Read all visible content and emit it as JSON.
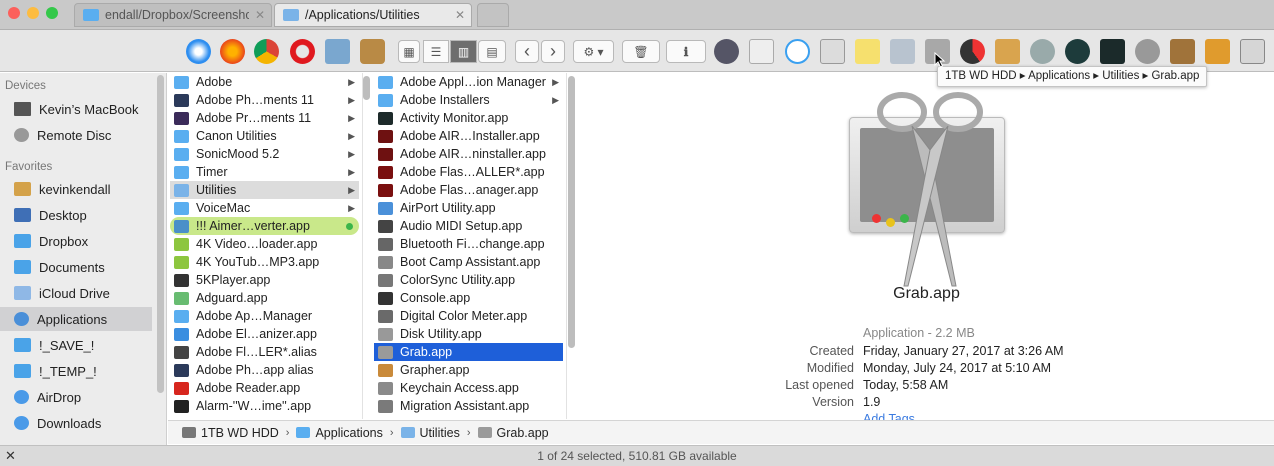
{
  "tabs": [
    {
      "label": "endall/Dropbox/Screenshots",
      "close": "✕",
      "active": false
    },
    {
      "label": "/Applications/Utilities",
      "close": "✕",
      "active": true
    }
  ],
  "toolbar": {
    "tooltip": "1TB WD HDD ▸ Applications ▸ Utilities ▸ Grab.app",
    "back": "‹",
    "forward": "›",
    "action": "⚙ ▾",
    "trash": "🗑",
    "info": "ℹ"
  },
  "sidebar": {
    "devices_header": "Devices",
    "devices": [
      {
        "label": "Kevin’s MacBook",
        "icon": "laptop-icon"
      },
      {
        "label": "Remote Disc",
        "icon": "disc-icon"
      }
    ],
    "favorites_header": "Favorites",
    "favorites": [
      {
        "label": "kevinkendall",
        "icon": "home-icon"
      },
      {
        "label": "Desktop",
        "icon": "desktop-icon"
      },
      {
        "label": "Dropbox",
        "icon": "folder-icon"
      },
      {
        "label": "Documents",
        "icon": "folder-icon"
      },
      {
        "label": "iCloud Drive",
        "icon": "cloud-icon"
      },
      {
        "label": "Applications",
        "icon": "applications-icon",
        "selected": true
      },
      {
        "label": "!_SAVE_!",
        "icon": "folder-icon"
      },
      {
        "label": "!_TEMP_!",
        "icon": "folder-icon"
      },
      {
        "label": "AirDrop",
        "icon": "airdrop-icon"
      },
      {
        "label": "Downloads",
        "icon": "downloads-icon"
      }
    ]
  },
  "column1": [
    {
      "label": "Adobe",
      "icon": "#5aaef0",
      "arrow": true
    },
    {
      "label": "Adobe Ph…ments 11",
      "icon": "#2b3a5a",
      "arrow": true
    },
    {
      "label": "Adobe Pr…ments 11",
      "icon": "#3b2b5a",
      "arrow": true
    },
    {
      "label": "Canon Utilities",
      "icon": "#5aaef0",
      "arrow": true
    },
    {
      "label": "SonicMood 5.2",
      "icon": "#5aaef0",
      "arrow": true
    },
    {
      "label": "Timer",
      "icon": "#5aaef0",
      "arrow": true
    },
    {
      "label": "Utilities",
      "icon": "#7ab3e8",
      "arrow": true,
      "selected": true
    },
    {
      "label": "VoiceMac",
      "icon": "#5aaef0",
      "arrow": true
    },
    {
      "label": "!!! Aimer…verter.app",
      "icon": "#4a90c8",
      "tag": true
    },
    {
      "label": "4K Video…loader.app",
      "icon": "#8dc63f"
    },
    {
      "label": "4K YouTub…MP3.app",
      "icon": "#8dc63f"
    },
    {
      "label": "5KPlayer.app",
      "icon": "#333333"
    },
    {
      "label": "Adguard.app",
      "icon": "#68bc71"
    },
    {
      "label": "Adobe Ap…Manager",
      "icon": "#5aaef0"
    },
    {
      "label": "Adobe El…anizer.app",
      "icon": "#3a8ee0"
    },
    {
      "label": "Adobe Fl…LER*.alias",
      "icon": "#444444"
    },
    {
      "label": "Adobe Ph…app alias",
      "icon": "#2b3a5a"
    },
    {
      "label": "Adobe Reader.app",
      "icon": "#d7261e"
    },
    {
      "label": "Alarm-''W…ime''.app",
      "icon": "#222222"
    }
  ],
  "column2": [
    {
      "label": "Adobe Appl…ion Manager",
      "icon": "#5aaef0",
      "arrow": true
    },
    {
      "label": "Adobe Installers",
      "icon": "#5aaef0",
      "arrow": true
    },
    {
      "label": "Activity Monitor.app",
      "icon": "#1d2a2a"
    },
    {
      "label": "Adobe AIR…Installer.app",
      "icon": "#6e1111"
    },
    {
      "label": "Adobe AIR…ninstaller.app",
      "icon": "#6e1111"
    },
    {
      "label": "Adobe Flas…ALLER*.app",
      "icon": "#7a0f0f"
    },
    {
      "label": "Adobe Flas…anager.app",
      "icon": "#7a0f0f"
    },
    {
      "label": "AirPort Utility.app",
      "icon": "#4a90d9"
    },
    {
      "label": "Audio MIDI Setup.app",
      "icon": "#444444"
    },
    {
      "label": "Bluetooth Fi…change.app",
      "icon": "#666666"
    },
    {
      "label": "Boot Camp Assistant.app",
      "icon": "#888888"
    },
    {
      "label": "ColorSync Utility.app",
      "icon": "#777777"
    },
    {
      "label": "Console.app",
      "icon": "#333333"
    },
    {
      "label": "Digital Color Meter.app",
      "icon": "#6a6a6a"
    },
    {
      "label": "Disk Utility.app",
      "icon": "#999999"
    },
    {
      "label": "Grab.app",
      "icon": "#9a9a9a",
      "selected": true
    },
    {
      "label": "Grapher.app",
      "icon": "#c98a3a"
    },
    {
      "label": "Keychain Access.app",
      "icon": "#8a8a8a"
    },
    {
      "label": "Migration Assistant.app",
      "icon": "#7a7a7a"
    }
  ],
  "preview": {
    "name": "Grab.app",
    "kind": "Application - 2.2 MB",
    "created_k": "Created",
    "created_v": "Friday, January 27, 2017 at 3:26 AM",
    "modified_k": "Modified",
    "modified_v": "Monday, July 24, 2017 at 5:10 AM",
    "opened_k": "Last opened",
    "opened_v": "Today, 5:58 AM",
    "version_k": "Version",
    "version_v": "1.9",
    "add_tags": "Add Tags…"
  },
  "pathbar": [
    {
      "label": "1TB WD HDD",
      "icon": "#777777"
    },
    {
      "label": "Applications",
      "icon": "#5aaef0"
    },
    {
      "label": "Utilities",
      "icon": "#7ab3e8"
    },
    {
      "label": "Grab.app",
      "icon": "#9a9a9a"
    }
  ],
  "status": "1 of 24 selected, 510.81 GB available"
}
